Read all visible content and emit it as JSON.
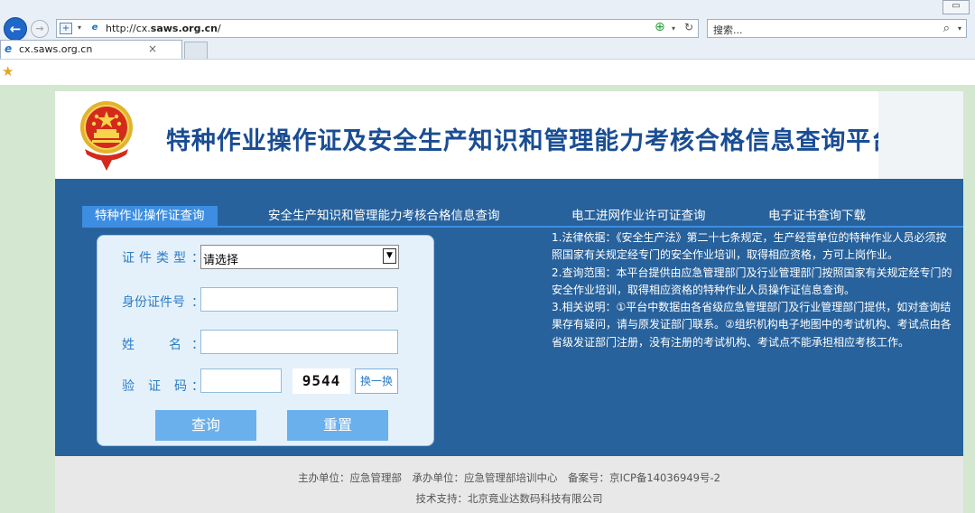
{
  "browser": {
    "url_prefix": "http://cx.",
    "url_host": "saws.org.cn",
    "url_suffix": "/",
    "search_placeholder": "搜索...",
    "tab_title": "cx.saws.org.cn",
    "tab_close": "×"
  },
  "site": {
    "title": "特种作业操作证及安全生产知识和管理能力考核合格信息查询平台"
  },
  "nav": [
    {
      "label": "特种作业操作证查询",
      "active": true
    },
    {
      "label": "安全生产知识和管理能力考核合格信息查询"
    },
    {
      "label": "电工进网作业许可证查询"
    },
    {
      "label": "电子证书查询下载"
    }
  ],
  "form": {
    "cert_type_label": "证件类型",
    "cert_type_value": "请选择",
    "id_label": "身份证件号",
    "name_label": "姓名",
    "code_label": "验证码",
    "colon": "：",
    "captcha_text": "9544",
    "refresh_label": "换一换",
    "query_button": "查询",
    "reset_button": "重置"
  },
  "notes": [
    "1.法律依据：《安全生产法》第二十七条规定，生产经营单位的特种作业人员必须按照国家有关规定经专门的安全作业培训，取得相应资格，方可上岗作业。",
    "2.查询范围：本平台提供由应急管理部门及行业管理部门按照国家有关规定经专门的安全作业培训，取得相应资格的特种作业人员操作证信息查询。",
    "3.相关说明：①平台中数据由各省级应急管理部门及行业管理部门提供，如对查询结果存有疑问，请与原发证部门联系。②组织机构电子地图中的考试机构、考试点由各省级发证部门注册，没有注册的考试机构、考试点不能承担相应考核工作。"
  ],
  "footer": {
    "line1": "主办单位：应急管理部　承办单位：应急管理部培训中心　备案号：京ICP备14036949号-2",
    "line2": "技术支持：北京竟业达数码科技有限公司"
  },
  "colors": {
    "panel": "#28629c",
    "active_tab": "#3d8ee2",
    "title": "#1a4d93",
    "button": "#6ab0ec"
  }
}
